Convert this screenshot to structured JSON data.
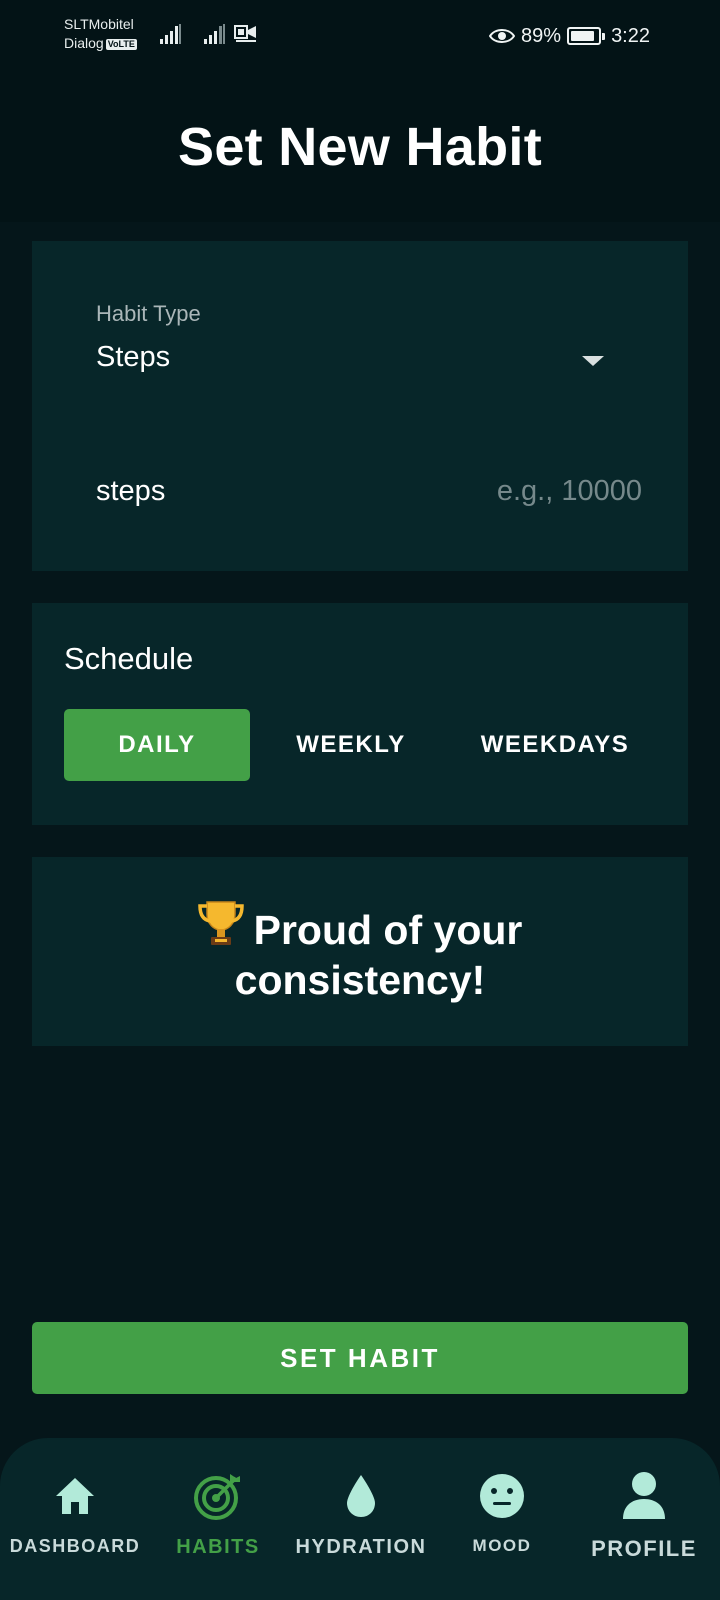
{
  "status_bar": {
    "carrier_1": "SLTMobitel",
    "carrier_2": "Dialog",
    "volte_badge": "VoLTE",
    "battery_percent": "89%",
    "battery_level": 0.89,
    "time": "3:22"
  },
  "header": {
    "title": "Set New Habit"
  },
  "habit_form": {
    "habit_type_label": "Habit Type",
    "habit_type_value": "Steps",
    "goal_unit": "steps",
    "goal_value": "",
    "goal_placeholder": "e.g., 10000"
  },
  "schedule": {
    "title": "Schedule",
    "options": [
      {
        "label": "DAILY",
        "selected": true
      },
      {
        "label": "WEEKLY",
        "selected": false
      },
      {
        "label": "WEEKDAYS",
        "selected": false
      }
    ]
  },
  "motivation": {
    "line_1": "Proud of your",
    "line_2": "consistency!",
    "icon": "trophy-icon"
  },
  "actions": {
    "set_habit_label": "SET HABIT"
  },
  "bottom_nav": {
    "active": "habits",
    "items": [
      {
        "label": "DASHBOARD",
        "icon": "home-icon"
      },
      {
        "label": "HABITS",
        "icon": "target-icon"
      },
      {
        "label": "HYDRATION",
        "icon": "water-drop-icon"
      },
      {
        "label": "MOOD",
        "icon": "neutral-face-icon"
      },
      {
        "label": "PROFILE",
        "icon": "person-icon"
      }
    ]
  },
  "colors": {
    "background": "#05161a",
    "card": "#072629",
    "accent_green": "#43a047",
    "nav_icon": "#b2ead9"
  }
}
